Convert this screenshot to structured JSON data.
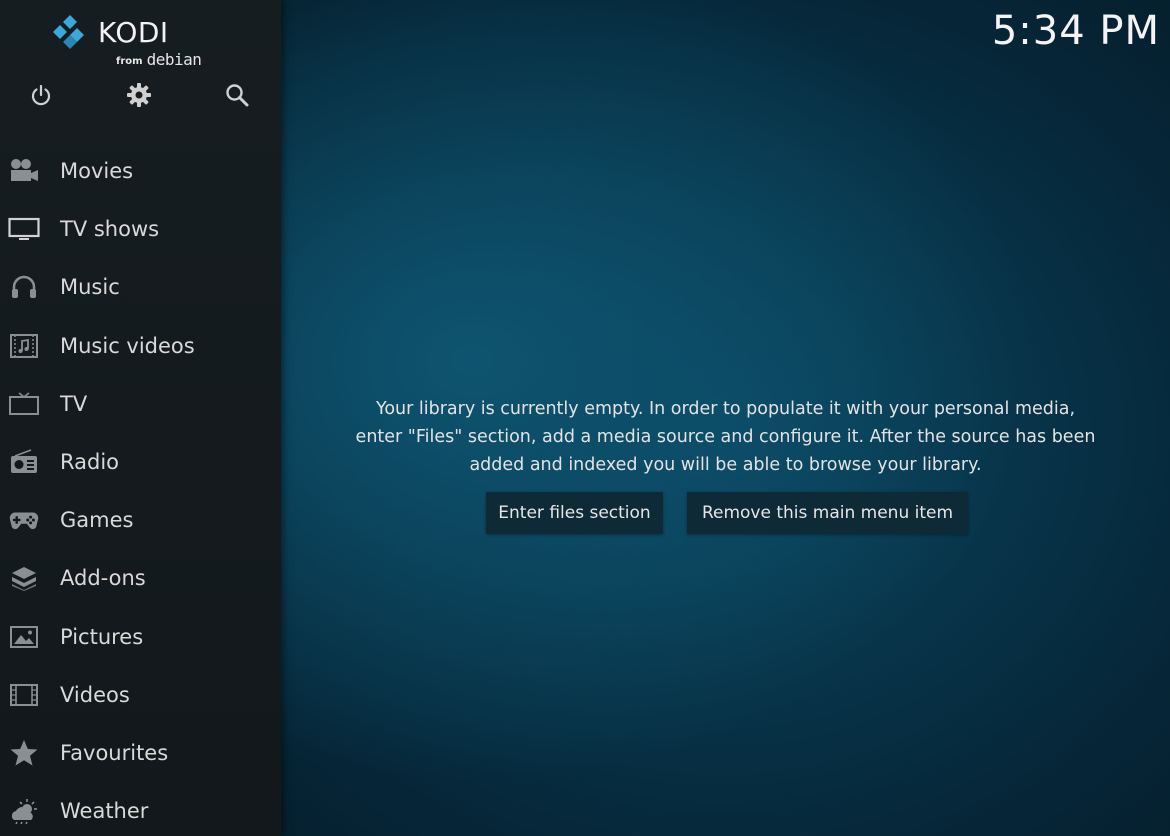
{
  "branding": {
    "app_name": "KODI",
    "from_text": "from",
    "distro_text": "debian",
    "accent_color": "#3aa8d8"
  },
  "top_icons": [
    {
      "name": "power-icon"
    },
    {
      "name": "gear-icon"
    },
    {
      "name": "search-icon"
    }
  ],
  "menu": {
    "items": [
      {
        "label": "Movies",
        "icon": "movie-camera-icon"
      },
      {
        "label": "TV shows",
        "icon": "monitor-icon"
      },
      {
        "label": "Music",
        "icon": "headphones-icon"
      },
      {
        "label": "Music videos",
        "icon": "music-video-icon"
      },
      {
        "label": "TV",
        "icon": "tv-icon"
      },
      {
        "label": "Radio",
        "icon": "radio-icon"
      },
      {
        "label": "Games",
        "icon": "gamepad-icon"
      },
      {
        "label": "Add-ons",
        "icon": "addons-box-icon"
      },
      {
        "label": "Pictures",
        "icon": "picture-icon"
      },
      {
        "label": "Videos",
        "icon": "film-strip-icon"
      },
      {
        "label": "Favourites",
        "icon": "star-icon"
      },
      {
        "label": "Weather",
        "icon": "weather-cloud-icon"
      }
    ]
  },
  "header": {
    "clock": "5:34 PM"
  },
  "main": {
    "message_lines": [
      "Your library is currently empty. In order to populate it with your personal media,",
      "enter \"Files\" section, add a media source and configure it. After the source has been",
      "added and indexed you will be able to browse your library."
    ],
    "buttons": {
      "enter_files": "Enter files section",
      "remove_item": "Remove this main menu item"
    }
  }
}
